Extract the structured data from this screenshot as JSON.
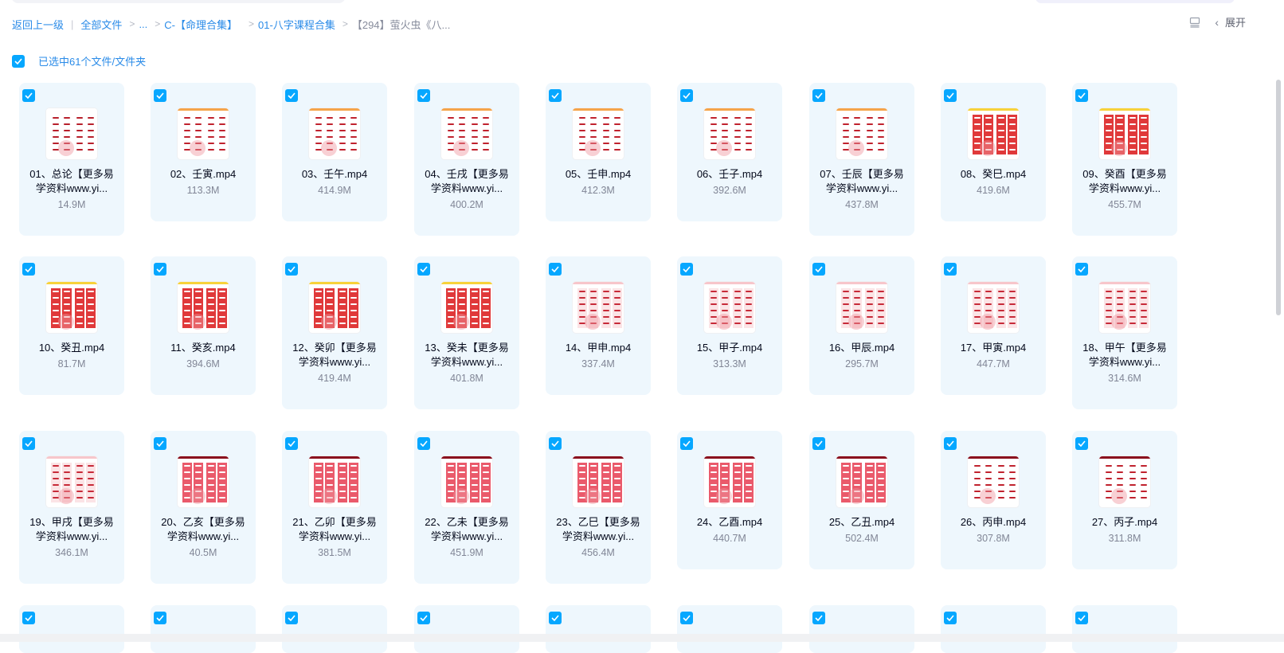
{
  "breadcrumb": {
    "back": "返回上一级",
    "all_files": "全部文件",
    "ellipsis": "...",
    "folder1": "C-【命理合集】",
    "folder2": "01-八字课程合集",
    "current": "【294】萤火虫《八...",
    "sep": ">"
  },
  "header": {
    "expand_label": "展开"
  },
  "selection": {
    "label": "已选中61个文件/文件夹"
  },
  "colors": {
    "accent": "#06a7ff",
    "link": "#2a8be8",
    "card_bg": "#eef7fd",
    "thumb_red": "#e0393a",
    "thumb_dark_red": "#8a0f1e"
  },
  "files": [
    {
      "name": "01、总论【更多易学资料www.yi...",
      "size": "14.9M",
      "thumb": "white"
    },
    {
      "name": "02、壬寅.mp4",
      "size": "113.3M",
      "thumb": "white-orange"
    },
    {
      "name": "03、壬午.mp4",
      "size": "414.9M",
      "thumb": "white-orange"
    },
    {
      "name": "04、壬戌【更多易学资料www.yi...",
      "size": "400.2M",
      "thumb": "white-orange"
    },
    {
      "name": "05、壬申.mp4",
      "size": "412.3M",
      "thumb": "white-orange"
    },
    {
      "name": "06、壬子.mp4",
      "size": "392.6M",
      "thumb": "white-orange"
    },
    {
      "name": "07、壬辰【更多易学资料www.yi...",
      "size": "437.8M",
      "thumb": "white-orange"
    },
    {
      "name": "08、癸巳.mp4",
      "size": "419.6M",
      "thumb": "red-yellow"
    },
    {
      "name": "09、癸酉【更多易学资料www.yi...",
      "size": "455.7M",
      "thumb": "red-yellow"
    },
    {
      "name": "10、癸丑.mp4",
      "size": "81.7M",
      "thumb": "red-yellow"
    },
    {
      "name": "11、癸亥.mp4",
      "size": "394.6M",
      "thumb": "red-yellow"
    },
    {
      "name": "12、癸卯【更多易学资料www.yi...",
      "size": "419.4M",
      "thumb": "red-yellow"
    },
    {
      "name": "13、癸未【更多易学资料www.yi...",
      "size": "401.8M",
      "thumb": "red-yellow"
    },
    {
      "name": "14、甲申.mp4",
      "size": "337.4M",
      "thumb": "pink"
    },
    {
      "name": "15、甲子.mp4",
      "size": "313.3M",
      "thumb": "pink"
    },
    {
      "name": "16、甲辰.mp4",
      "size": "295.7M",
      "thumb": "pink"
    },
    {
      "name": "17、甲寅.mp4",
      "size": "447.7M",
      "thumb": "pink"
    },
    {
      "name": "18、甲午【更多易学资料www.yi...",
      "size": "314.6M",
      "thumb": "pink"
    },
    {
      "name": "19、甲戌【更多易学资料www.yi...",
      "size": "346.1M",
      "thumb": "pink"
    },
    {
      "name": "20、乙亥【更多易学资料www.yi...",
      "size": "40.5M",
      "thumb": "rose"
    },
    {
      "name": "21、乙卯【更多易学资料www.yi...",
      "size": "381.5M",
      "thumb": "rose"
    },
    {
      "name": "22、乙未【更多易学资料www.yi...",
      "size": "451.9M",
      "thumb": "rose"
    },
    {
      "name": "23、乙巳【更多易学资料www.yi...",
      "size": "456.4M",
      "thumb": "rose"
    },
    {
      "name": "24、乙酉.mp4",
      "size": "440.7M",
      "thumb": "rose"
    },
    {
      "name": "25、乙丑.mp4",
      "size": "502.4M",
      "thumb": "rose"
    },
    {
      "name": "26、丙申.mp4",
      "size": "307.8M",
      "thumb": "white-dark"
    },
    {
      "name": "27、丙子.mp4",
      "size": "311.8M",
      "thumb": "white-dark"
    },
    {
      "name": "",
      "size": "",
      "thumb": "partial"
    },
    {
      "name": "",
      "size": "",
      "thumb": "partial"
    },
    {
      "name": "",
      "size": "",
      "thumb": "partial"
    },
    {
      "name": "",
      "size": "",
      "thumb": "partial"
    },
    {
      "name": "",
      "size": "",
      "thumb": "partial"
    },
    {
      "name": "",
      "size": "",
      "thumb": "partial"
    },
    {
      "name": "",
      "size": "",
      "thumb": "partial"
    },
    {
      "name": "",
      "size": "",
      "thumb": "partial"
    },
    {
      "name": "",
      "size": "",
      "thumb": "partial"
    }
  ]
}
